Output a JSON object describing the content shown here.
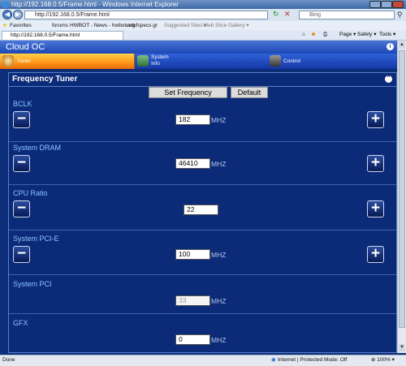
{
  "window": {
    "title": "http://192.168.0.5/Frame.html - Windows Internet Explorer",
    "url": "http://192.168.0.5/Frame.html",
    "search_placeholder": "Bing"
  },
  "favorites": {
    "favorites_label": "Favorites",
    "items": [
      "forums",
      "HWBOT - News - hwbot.org",
      "outofspecs.gr",
      "Suggested Sites ▾",
      "Web Slice Gallery ▾"
    ]
  },
  "tab": {
    "label": "http://192.168.0.5/Frame.html"
  },
  "ie_toolbar": {
    "page": "Page ▾",
    "safety": "Safety ▾",
    "tools": "Tools ▾"
  },
  "app": {
    "title": "Cloud OC",
    "menu": [
      {
        "label": "Tuner",
        "active": true
      },
      {
        "label": "System\nInfo",
        "active": false
      },
      {
        "label": "Control",
        "active": false
      }
    ]
  },
  "panel": {
    "title": "Frequency Tuner",
    "set_frequency_label": "Set Frequency",
    "default_label": "Default",
    "rows": [
      {
        "label": "BCLK",
        "value": "182",
        "unit": "MHZ",
        "controls": true
      },
      {
        "label": "System DRAM",
        "value": "46410",
        "unit": "MHZ",
        "controls": true
      },
      {
        "label": "CPU Ratio",
        "value": "22",
        "unit": "",
        "controls": true
      },
      {
        "label": "System PCI-E",
        "value": "100",
        "unit": "MHZ",
        "controls": true
      },
      {
        "label": "System PCI",
        "value": "33",
        "unit": "MHZ",
        "controls": false
      },
      {
        "label": "GFX",
        "value": "0",
        "unit": "MHZ",
        "controls": false
      }
    ]
  },
  "statusbar": {
    "left": "Done",
    "zone": "Internet | Protected Mode: Off",
    "zoom": "⊕ 100% ▾"
  },
  "colors": {
    "accent_orange": "#ff9a1c",
    "app_blue": "#1d47b3",
    "panel_bg": "#0b2a78",
    "label_blue": "#8fc6ff"
  }
}
